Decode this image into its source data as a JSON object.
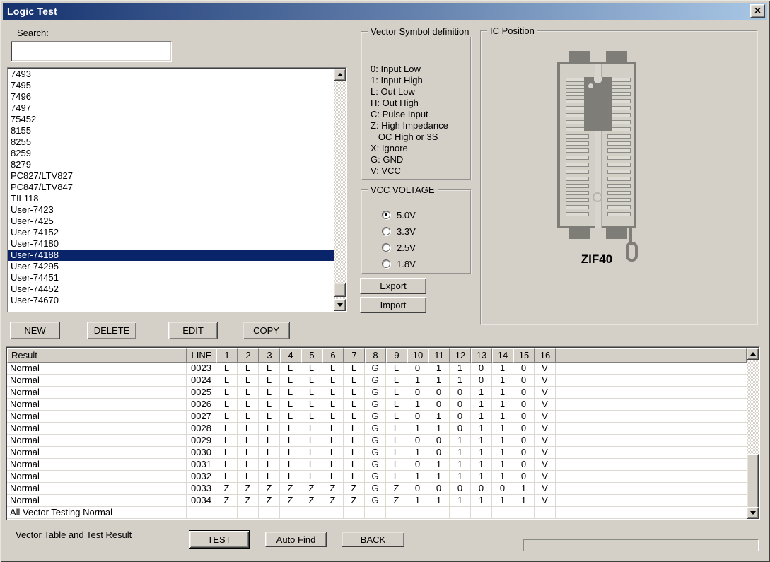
{
  "window": {
    "title": "Logic Test",
    "close_glyph": "×"
  },
  "search": {
    "label": "Search:",
    "value": ""
  },
  "device_list": {
    "items": [
      "7493",
      "7495",
      "7496",
      "7497",
      "75452",
      "8155",
      "8255",
      "8259",
      "8279",
      "PC827/LTV827",
      "PC847/LTV847",
      "TIL118",
      "User-7423",
      "User-7425",
      "User-74152",
      "User-74180",
      "User-74188",
      "User-74295",
      "User-74451",
      "User-74452",
      "User-74670"
    ],
    "selected_index": 16,
    "selected_item": "User-74188"
  },
  "list_actions": {
    "new": "NEW",
    "delete": "DELETE",
    "edit": "EDIT",
    "copy": "COPY"
  },
  "vector_symbols": {
    "title": "Vector Symbol definition",
    "lines": [
      "0: Input Low",
      "1: Input High",
      "L: Out Low",
      "H: Out High",
      "C: Pulse Input",
      "Z: High Impedance",
      "   OC High or 3S",
      "X: Ignore",
      "G: GND",
      "V: VCC"
    ]
  },
  "vcc_voltage": {
    "title": "VCC VOLTAGE",
    "options": [
      {
        "label": "5.0V",
        "selected": true
      },
      {
        "label": "3.3V",
        "selected": false
      },
      {
        "label": "2.5V",
        "selected": false
      },
      {
        "label": "1.8V",
        "selected": false
      }
    ]
  },
  "transfer": {
    "export": "Export",
    "import": "Import"
  },
  "ic_position": {
    "title": "IC Position",
    "socket_label": "ZIF40"
  },
  "result_table": {
    "result_header": "Result",
    "line_header": "LINE",
    "pin_headers": [
      "1",
      "2",
      "3",
      "4",
      "5",
      "6",
      "7",
      "8",
      "9",
      "10",
      "11",
      "12",
      "13",
      "14",
      "15",
      "16"
    ],
    "rows": [
      {
        "result": "Normal",
        "line": "0023",
        "values": [
          "L",
          "L",
          "L",
          "L",
          "L",
          "L",
          "L",
          "G",
          "L",
          "0",
          "1",
          "1",
          "0",
          "1",
          "0",
          "V"
        ]
      },
      {
        "result": "Normal",
        "line": "0024",
        "values": [
          "L",
          "L",
          "L",
          "L",
          "L",
          "L",
          "L",
          "G",
          "L",
          "1",
          "1",
          "1",
          "0",
          "1",
          "0",
          "V"
        ]
      },
      {
        "result": "Normal",
        "line": "0025",
        "values": [
          "L",
          "L",
          "L",
          "L",
          "L",
          "L",
          "L",
          "G",
          "L",
          "0",
          "0",
          "0",
          "1",
          "1",
          "0",
          "V"
        ]
      },
      {
        "result": "Normal",
        "line": "0026",
        "values": [
          "L",
          "L",
          "L",
          "L",
          "L",
          "L",
          "L",
          "G",
          "L",
          "1",
          "0",
          "0",
          "1",
          "1",
          "0",
          "V"
        ]
      },
      {
        "result": "Normal",
        "line": "0027",
        "values": [
          "L",
          "L",
          "L",
          "L",
          "L",
          "L",
          "L",
          "G",
          "L",
          "0",
          "1",
          "0",
          "1",
          "1",
          "0",
          "V"
        ]
      },
      {
        "result": "Normal",
        "line": "0028",
        "values": [
          "L",
          "L",
          "L",
          "L",
          "L",
          "L",
          "L",
          "G",
          "L",
          "1",
          "1",
          "0",
          "1",
          "1",
          "0",
          "V"
        ]
      },
      {
        "result": "Normal",
        "line": "0029",
        "values": [
          "L",
          "L",
          "L",
          "L",
          "L",
          "L",
          "L",
          "G",
          "L",
          "0",
          "0",
          "1",
          "1",
          "1",
          "0",
          "V"
        ]
      },
      {
        "result": "Normal",
        "line": "0030",
        "values": [
          "L",
          "L",
          "L",
          "L",
          "L",
          "L",
          "L",
          "G",
          "L",
          "1",
          "0",
          "1",
          "1",
          "1",
          "0",
          "V"
        ]
      },
      {
        "result": "Normal",
        "line": "0031",
        "values": [
          "L",
          "L",
          "L",
          "L",
          "L",
          "L",
          "L",
          "G",
          "L",
          "0",
          "1",
          "1",
          "1",
          "1",
          "0",
          "V"
        ]
      },
      {
        "result": "Normal",
        "line": "0032",
        "values": [
          "L",
          "L",
          "L",
          "L",
          "L",
          "L",
          "L",
          "G",
          "L",
          "1",
          "1",
          "1",
          "1",
          "1",
          "0",
          "V"
        ]
      },
      {
        "result": "Normal",
        "line": "0033",
        "values": [
          "Z",
          "Z",
          "Z",
          "Z",
          "Z",
          "Z",
          "Z",
          "G",
          "Z",
          "0",
          "0",
          "0",
          "0",
          "0",
          "1",
          "V"
        ]
      },
      {
        "result": "Normal",
        "line": "0034",
        "values": [
          "Z",
          "Z",
          "Z",
          "Z",
          "Z",
          "Z",
          "Z",
          "G",
          "Z",
          "1",
          "1",
          "1",
          "1",
          "1",
          "1",
          "V"
        ]
      }
    ],
    "footer": "All Vector Testing Normal"
  },
  "footer": {
    "caption": "Vector Table and Test Result",
    "test": "TEST",
    "auto_find": "Auto Find",
    "back": "BACK"
  },
  "colors": {
    "dialog_bg": "#d4d0c8",
    "titlebar_start": "#15316e",
    "titlebar_end": "#a8c6e4",
    "selection": "#0a246a"
  }
}
